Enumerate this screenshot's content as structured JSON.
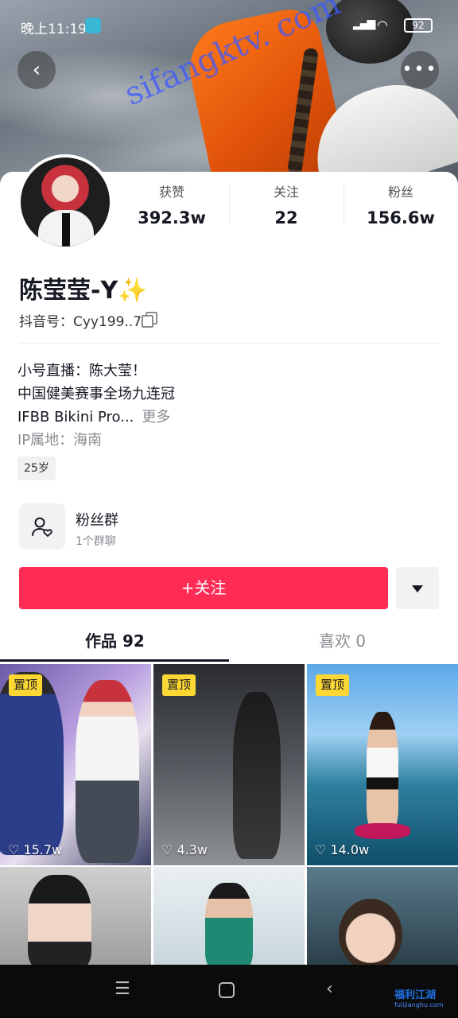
{
  "status_bar": {
    "time": "晚上11:19",
    "battery": "92"
  },
  "watermark": "sifangktv. com",
  "profile": {
    "name": "陈莹莹-Y✨",
    "douyin_id": "抖音号：Cyy199..7",
    "stats": [
      {
        "label": "获赞",
        "value": "392.3w"
      },
      {
        "label": "关注",
        "value": "22"
      },
      {
        "label": "粉丝",
        "value": "156.6w"
      }
    ],
    "bio_lines": [
      "小号直播：陈大莹！",
      "中国健美赛事全场九连冠",
      "IFBB Bikini Pro..."
    ],
    "bio_more": "更多",
    "ip_location": "IP属地：海南",
    "age_tag": "25岁"
  },
  "fan_group": {
    "title": "粉丝群",
    "subtitle": "1个群聊"
  },
  "actions": {
    "follow_label": "+关注"
  },
  "tabs": [
    {
      "label": "作品 92",
      "active": true
    },
    {
      "label": "喜欢 0",
      "active": false
    }
  ],
  "videos": [
    {
      "pinned_label": "置顶",
      "likes": "15.7w"
    },
    {
      "pinned_label": "置顶",
      "likes": "4.3w"
    },
    {
      "pinned_label": "置顶",
      "likes": "14.0w"
    }
  ],
  "corner_logo": {
    "text": "福利江湖",
    "sub": "fulijianghu.com"
  },
  "colors": {
    "accent": "#fe2c55",
    "pin_badge": "#fdd835"
  }
}
